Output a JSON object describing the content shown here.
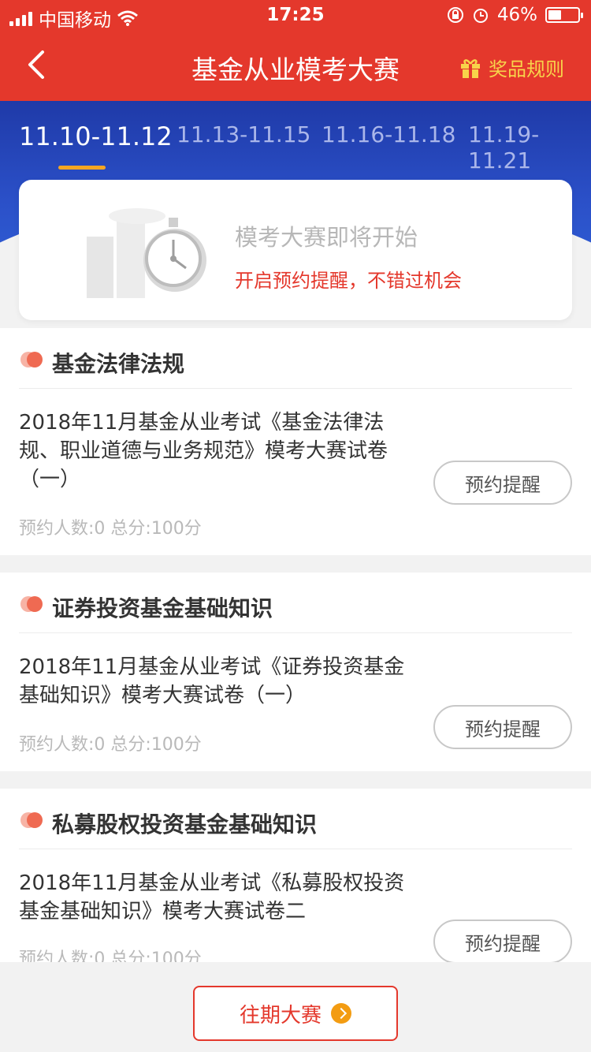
{
  "status_bar": {
    "carrier": "中国移动",
    "time": "17:25",
    "battery": "46%"
  },
  "nav": {
    "title": "基金从业模考大赛",
    "rules_label": "奖品规则"
  },
  "tabs": [
    {
      "label": "11.10-11.12",
      "active": true
    },
    {
      "label": "11.13-11.15",
      "active": false
    },
    {
      "label": "11.16-11.18",
      "active": false
    },
    {
      "label": "11.19-11.21",
      "active": false
    }
  ],
  "upcoming": {
    "title": "模考大赛即将开始",
    "subtitle": "开启预约提醒，不错过机会"
  },
  "sections": [
    {
      "title": "基金法律法规",
      "desc": "2018年11月基金从业考试《基金法律法规、职业道德与业务规范》模考大赛试卷（一）",
      "meta": "预约人数:0   总分:100分",
      "button": "预约提醒"
    },
    {
      "title": "证券投资基金基础知识",
      "desc": "2018年11月基金从业考试《证券投资基金基础知识》模考大赛试卷（一）",
      "meta": "预约人数:0   总分:100分",
      "button": "预约提醒"
    },
    {
      "title": "私募股权投资基金基础知识",
      "desc": "2018年11月基金从业考试《私募股权投资基金基础知识》模考大赛试卷二",
      "meta": "预约人数:0   总分:100分",
      "button": "预约提醒"
    }
  ],
  "bottom": {
    "past_label": "往期大赛"
  }
}
